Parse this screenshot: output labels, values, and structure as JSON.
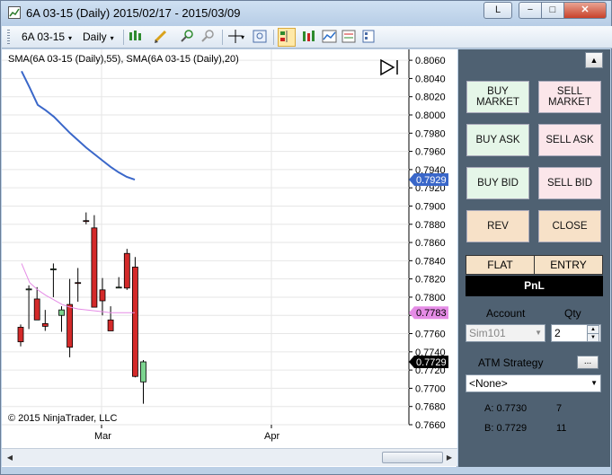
{
  "window": {
    "title": "6A 03-15 (Daily)  2015/02/17 - 2015/03/09",
    "link_label": "L",
    "min_symbol": "−",
    "max_symbol": "□",
    "close_symbol": "✕"
  },
  "toolbar": {
    "instrument": "6A 03-15",
    "interval": "Daily",
    "instrument_arrow": "▾",
    "interval_arrow": "▾"
  },
  "chart": {
    "indicator_label": "SMA(6A 03-15 (Daily),55), SMA(6A 03-15 (Daily),20)",
    "copyright": "© 2015 NinjaTrader, LLC",
    "x_labels": [
      "Mar",
      "Apr"
    ],
    "price_ticks": [
      "0.8060",
      "0.8040",
      "0.8020",
      "0.8000",
      "0.7980",
      "0.7960",
      "0.7940",
      "0.7920",
      "0.7900",
      "0.7880",
      "0.7860",
      "0.7840",
      "0.7820",
      "0.7800",
      "0.7780",
      "0.7760",
      "0.7740",
      "0.7720",
      "0.7700",
      "0.7680",
      "0.7660"
    ],
    "markers": [
      {
        "label": "0.7929",
        "color": "#3a67c9",
        "text_color": "#ffffff"
      },
      {
        "label": "0.7783",
        "color": "#e58ce6",
        "text_color": "#000000"
      },
      {
        "label": "0.7729",
        "color": "#000000",
        "text_color": "#ffffff"
      }
    ]
  },
  "chart_data": {
    "type": "candlestick",
    "title": "",
    "xlabel": "",
    "ylabel": "",
    "ylim": [
      0.766,
      0.8068
    ],
    "x": [
      "2015-02-17",
      "2015-02-18",
      "2015-02-19",
      "2015-02-20",
      "2015-02-23",
      "2015-02-24",
      "2015-02-25",
      "2015-02-26",
      "2015-02-27",
      "2015-03-02",
      "2015-03-03",
      "2015-03-04",
      "2015-03-05",
      "2015-03-06",
      "2015-03-09"
    ],
    "ohlc": [
      [
        0.7767,
        0.777,
        0.7746,
        0.7751
      ],
      [
        0.7808,
        0.7813,
        0.7765,
        0.7809
      ],
      [
        0.7798,
        0.7811,
        0.7775,
        0.7775
      ],
      [
        0.7771,
        0.7786,
        0.7763,
        0.7768
      ],
      [
        0.783,
        0.7837,
        0.78,
        0.7831
      ],
      [
        0.778,
        0.779,
        0.7762,
        0.7786
      ],
      [
        0.7792,
        0.782,
        0.7734,
        0.7745
      ],
      [
        0.7816,
        0.7832,
        0.7795,
        0.7815
      ],
      [
        0.7884,
        0.7893,
        0.788,
        0.7883
      ],
      [
        0.7876,
        0.789,
        0.7791,
        0.7789
      ],
      [
        0.7808,
        0.7821,
        0.778,
        0.7796
      ],
      [
        0.7775,
        0.779,
        0.7763,
        0.7763
      ],
      [
        0.7811,
        0.7822,
        0.781,
        0.7811
      ],
      [
        0.7848,
        0.7853,
        0.7808,
        0.781
      ],
      [
        0.7833,
        0.7844,
        0.7712,
        0.7713
      ],
      [
        0.7707,
        0.7731,
        0.7683,
        0.7729
      ]
    ],
    "series": [
      {
        "name": "SMA(6A 03-15 (Daily),55)",
        "color": "#3a67c9",
        "values": [
          0.8048,
          0.803,
          0.8011,
          0.8005,
          0.7998,
          0.7989,
          0.798,
          0.7972,
          0.7964,
          0.7957,
          0.795,
          0.7943,
          0.7937,
          0.7932,
          0.7929
        ]
      },
      {
        "name": "SMA(6A 03-15 (Daily),20)",
        "color": "#e58ce6",
        "values": [
          0.7837,
          0.7816,
          0.7808,
          0.7802,
          0.7797,
          0.7792,
          0.7789,
          0.7787,
          0.7786,
          0.7785,
          0.7784,
          0.7783,
          0.7783,
          0.7783,
          0.7783
        ]
      }
    ],
    "up_color": "#7cd48f",
    "down_color": "#d42a2a",
    "grid": true
  },
  "panel": {
    "toggle_symbol": "▲",
    "buy_market": "BUY MARKET",
    "sell_market": "SELL MARKET",
    "buy_ask": "BUY ASK",
    "sell_ask": "SELL ASK",
    "buy_bid": "BUY BID",
    "sell_bid": "SELL BID",
    "rev": "REV",
    "close": "CLOSE",
    "flat": "FLAT",
    "entry": "ENTRY",
    "pnl": "PnL",
    "account_label": "Account",
    "qty_label": "Qty",
    "account_value": "Sim101",
    "qty_value": "2",
    "atm_label": "ATM Strategy",
    "atm_button": "...",
    "atm_value": "<None>",
    "ask_label": "A: 0.7730",
    "ask_size": "7",
    "bid_label": "B: 0.7729",
    "bid_size": "11"
  }
}
